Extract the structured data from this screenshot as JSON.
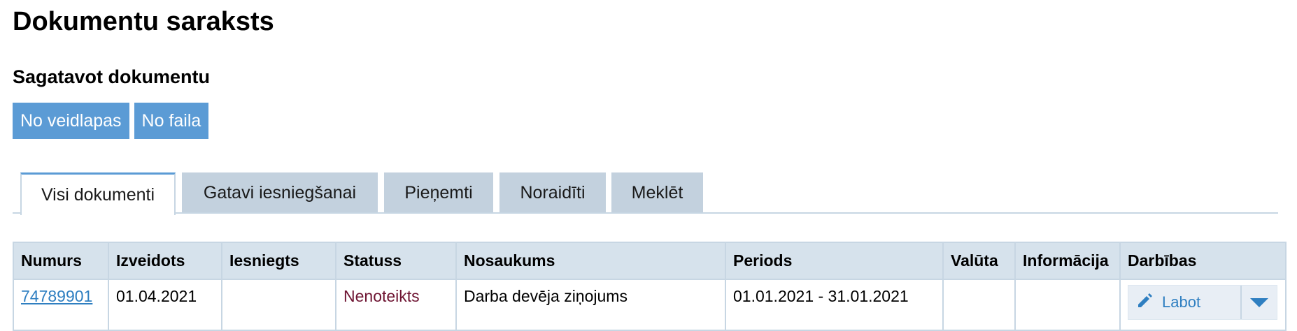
{
  "page": {
    "title": "Dokumentu saraksts"
  },
  "prepare": {
    "title": "Sagatavot dokumentu",
    "buttons": [
      "No veidlapas",
      "No faila"
    ]
  },
  "tabs": [
    "Visi dokumenti",
    "Gatavi iesniegšanai",
    "Pieņemti",
    "Noraidīti",
    "Meklēt"
  ],
  "active_tab": "Visi dokumenti",
  "table": {
    "headers": [
      "Numurs",
      "Izveidots",
      "Iesniegts",
      "Statuss",
      "Nosaukums",
      "Periods",
      "Valūta",
      "Informācija",
      "Darbības"
    ],
    "rows": [
      {
        "number": "74789901",
        "created": "01.04.2021",
        "submitted": "",
        "status": "Nenoteikts",
        "name": "Darba devēja ziņojums",
        "period": "01.01.2021 - 31.01.2021",
        "currency": "",
        "info": "",
        "action_label": "Labot",
        "action_icon": "pencil-icon",
        "toggle_icon": "caret-down-icon"
      }
    ]
  },
  "colors": {
    "accent": "#5b9bd5",
    "tab_inactive": "#c3d1de",
    "header_bg": "#d6e2ec",
    "link": "#2f7fc1",
    "status": "#6e1432"
  }
}
